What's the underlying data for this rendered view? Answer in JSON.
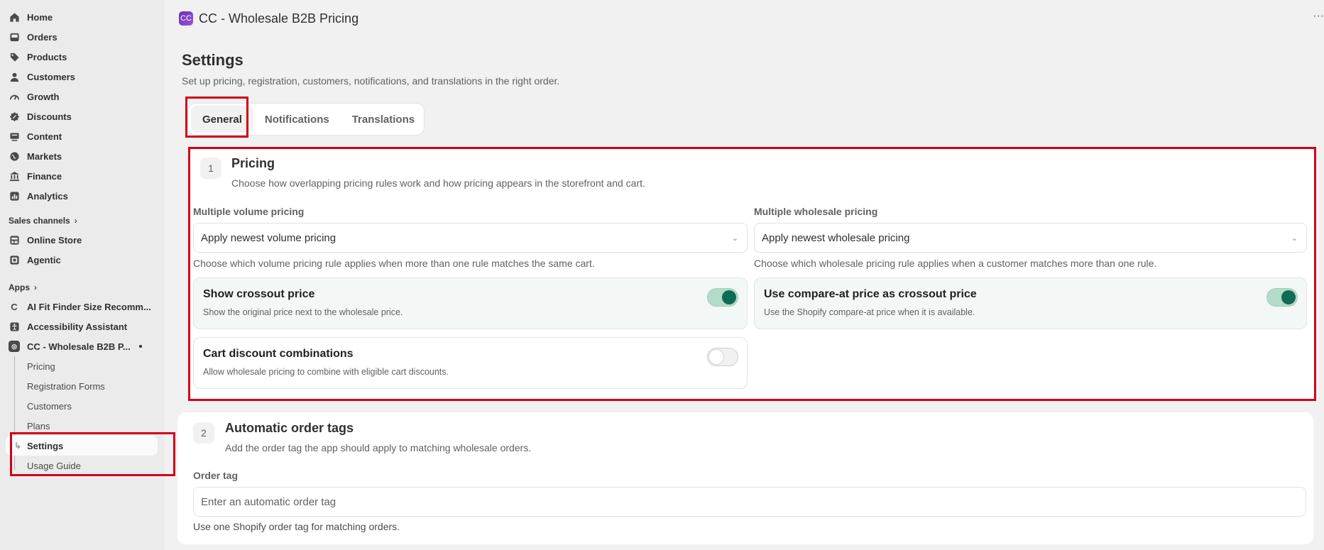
{
  "sidebar": {
    "nav": [
      {
        "label": "Home",
        "icon": "home-icon"
      },
      {
        "label": "Orders",
        "icon": "inbox-icon"
      },
      {
        "label": "Products",
        "icon": "tag-icon"
      },
      {
        "label": "Customers",
        "icon": "person-icon"
      },
      {
        "label": "Growth",
        "icon": "gauge-icon"
      },
      {
        "label": "Discounts",
        "icon": "discount-icon"
      },
      {
        "label": "Content",
        "icon": "content-icon"
      },
      {
        "label": "Markets",
        "icon": "globe-icon"
      },
      {
        "label": "Finance",
        "icon": "bank-icon"
      },
      {
        "label": "Analytics",
        "icon": "chart-icon"
      }
    ],
    "sales_channels_label": "Sales channels",
    "channels": [
      {
        "label": "Online Store",
        "icon": "store-icon"
      },
      {
        "label": "Agentic",
        "icon": "agentic-icon"
      }
    ],
    "apps_label": "Apps",
    "apps": [
      {
        "label": "AI Fit Finder Size Recomm...",
        "icon": "c-icon"
      },
      {
        "label": "Accessibility Assistant",
        "icon": "accessibility-icon"
      },
      {
        "label": "CC - Wholesale B2B P...",
        "icon": "app-logo-icon"
      }
    ],
    "app_subitems": [
      "Pricing",
      "Registration Forms",
      "Customers",
      "Plans",
      "Settings",
      "Usage Guide"
    ],
    "active_subitem": "Settings"
  },
  "topbar": {
    "title": "CC - Wholesale B2B Pricing",
    "logo_text": "CC",
    "more_label": "···"
  },
  "page": {
    "title": "Settings",
    "subtitle": "Set up pricing, registration, customers, notifications, and translations in the right order."
  },
  "tabs": [
    "General",
    "Notifications",
    "Translations"
  ],
  "active_tab": "General",
  "pricing": {
    "number": "1",
    "title": "Pricing",
    "description": "Choose how overlapping pricing rules work and how pricing appears in the storefront and cart.",
    "volume_label": "Multiple volume pricing",
    "volume_value": "Apply newest volume pricing",
    "volume_help": "Choose which volume pricing rule applies when more than one rule matches the same cart.",
    "wholesale_label": "Multiple wholesale pricing",
    "wholesale_value": "Apply newest wholesale pricing",
    "wholesale_help": "Choose which wholesale pricing rule applies when a customer matches more than one rule.",
    "toggles": [
      {
        "title": "Show crossout price",
        "description": "Show the original price next to the wholesale price.",
        "on": true
      },
      {
        "title": "Use compare-at price as crossout price",
        "description": "Use the Shopify compare-at price when it is available.",
        "on": true
      },
      {
        "title": "Cart discount combinations",
        "description": "Allow wholesale pricing to combine with eligible cart discounts.",
        "on": false
      }
    ]
  },
  "order_tags": {
    "number": "2",
    "title": "Automatic order tags",
    "description": "Add the order tag the app should apply to matching wholesale orders.",
    "field_label": "Order tag",
    "placeholder": "Enter an automatic order tag",
    "help": "Use one Shopify order tag for matching orders."
  },
  "colors": {
    "highlight": "#d0021b",
    "toggle_on": "#0f6b52",
    "sidebar_bg": "#ebebeb",
    "page_bg": "#f1f1f1"
  }
}
